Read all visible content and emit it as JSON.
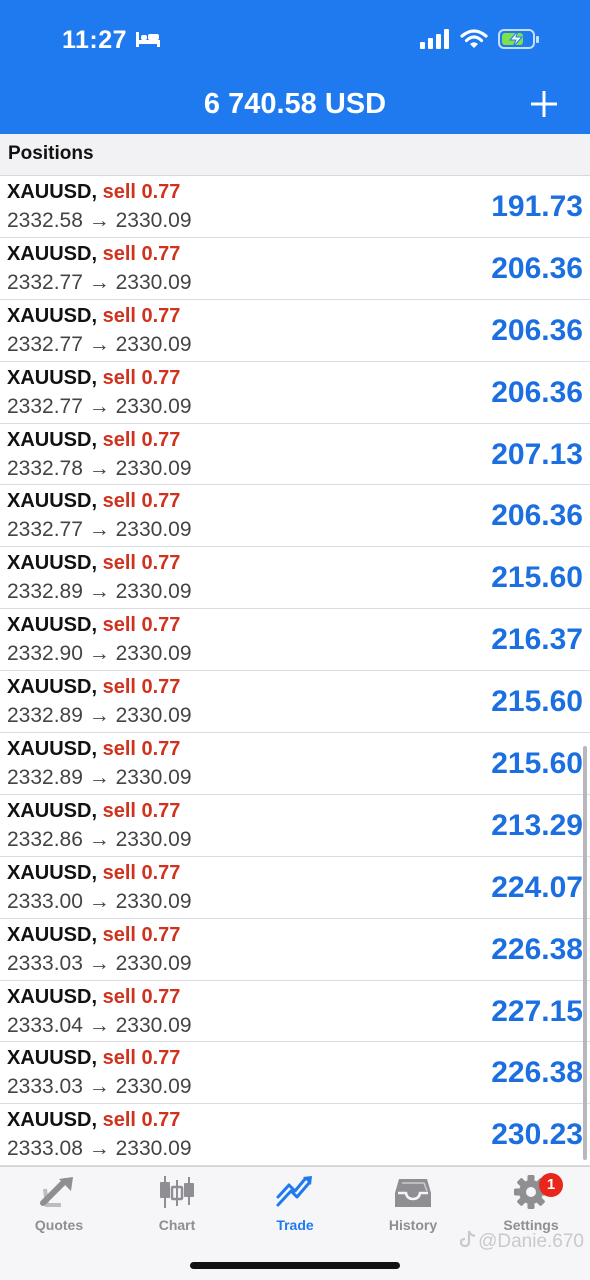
{
  "status_bar": {
    "time": "11:27"
  },
  "header": {
    "title": "6 740.58 USD"
  },
  "section": {
    "label": "Positions"
  },
  "positions": [
    {
      "symbol": "XAUUSD,",
      "side": "sell 0.77",
      "open": "2332.58",
      "arrow": "→",
      "current": "2330.09",
      "profit": "191.73"
    },
    {
      "symbol": "XAUUSD,",
      "side": "sell 0.77",
      "open": "2332.77",
      "arrow": "→",
      "current": "2330.09",
      "profit": "206.36"
    },
    {
      "symbol": "XAUUSD,",
      "side": "sell 0.77",
      "open": "2332.77",
      "arrow": "→",
      "current": "2330.09",
      "profit": "206.36"
    },
    {
      "symbol": "XAUUSD,",
      "side": "sell 0.77",
      "open": "2332.77",
      "arrow": "→",
      "current": "2330.09",
      "profit": "206.36"
    },
    {
      "symbol": "XAUUSD,",
      "side": "sell 0.77",
      "open": "2332.78",
      "arrow": "→",
      "current": "2330.09",
      "profit": "207.13"
    },
    {
      "symbol": "XAUUSD,",
      "side": "sell 0.77",
      "open": "2332.77",
      "arrow": "→",
      "current": "2330.09",
      "profit": "206.36"
    },
    {
      "symbol": "XAUUSD,",
      "side": "sell 0.77",
      "open": "2332.89",
      "arrow": "→",
      "current": "2330.09",
      "profit": "215.60"
    },
    {
      "symbol": "XAUUSD,",
      "side": "sell 0.77",
      "open": "2332.90",
      "arrow": "→",
      "current": "2330.09",
      "profit": "216.37"
    },
    {
      "symbol": "XAUUSD,",
      "side": "sell 0.77",
      "open": "2332.89",
      "arrow": "→",
      "current": "2330.09",
      "profit": "215.60"
    },
    {
      "symbol": "XAUUSD,",
      "side": "sell 0.77",
      "open": "2332.89",
      "arrow": "→",
      "current": "2330.09",
      "profit": "215.60"
    },
    {
      "symbol": "XAUUSD,",
      "side": "sell 0.77",
      "open": "2332.86",
      "arrow": "→",
      "current": "2330.09",
      "profit": "213.29"
    },
    {
      "symbol": "XAUUSD,",
      "side": "sell 0.77",
      "open": "2333.00",
      "arrow": "→",
      "current": "2330.09",
      "profit": "224.07"
    },
    {
      "symbol": "XAUUSD,",
      "side": "sell 0.77",
      "open": "2333.03",
      "arrow": "→",
      "current": "2330.09",
      "profit": "226.38"
    },
    {
      "symbol": "XAUUSD,",
      "side": "sell 0.77",
      "open": "2333.04",
      "arrow": "→",
      "current": "2330.09",
      "profit": "227.15"
    },
    {
      "symbol": "XAUUSD,",
      "side": "sell 0.77",
      "open": "2333.03",
      "arrow": "→",
      "current": "2330.09",
      "profit": "226.38"
    },
    {
      "symbol": "XAUUSD,",
      "side": "sell 0.77",
      "open": "2333.08",
      "arrow": "→",
      "current": "2330.09",
      "profit": "230.23"
    }
  ],
  "tabs": [
    {
      "label": "Quotes",
      "icon": "quotes-icon"
    },
    {
      "label": "Chart",
      "icon": "chart-icon"
    },
    {
      "label": "Trade",
      "icon": "trade-icon",
      "active": true
    },
    {
      "label": "History",
      "icon": "history-icon"
    },
    {
      "label": "Settings",
      "icon": "settings-icon",
      "badge": "1"
    }
  ],
  "watermark": {
    "text": "@Danie.670"
  },
  "colors": {
    "brand_blue": "#1f7af0",
    "sell_red": "#d0321e",
    "profit_blue": "#1b6fe0",
    "badge_red": "#e8261c",
    "tab_inactive": "#8e8e93"
  }
}
